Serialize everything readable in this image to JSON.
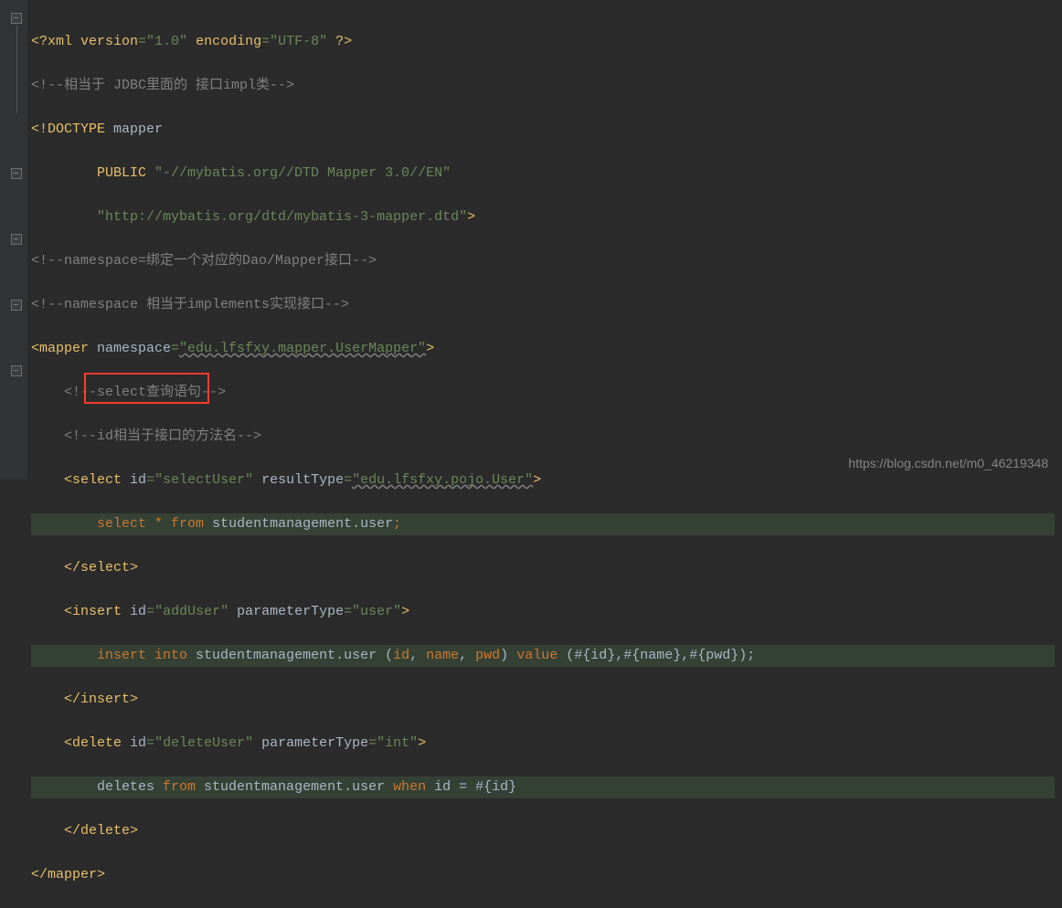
{
  "code": {
    "l1": {
      "a": "<?",
      "b": "xml version",
      "c": "=\"1.0\" ",
      "d": "encoding",
      "e": "=\"UTF-8\" ",
      "f": "?>"
    },
    "l2": "<!--相当于 JDBC里面的 接口impl类-->",
    "l3": {
      "a": "<!",
      "b": "DOCTYPE ",
      "c": "mapper"
    },
    "l4": {
      "a": "PUBLIC ",
      "b": "\"-//mybatis.org//DTD Mapper 3.0//EN\""
    },
    "l5": "\"http://mybatis.org/dtd/mybatis-3-mapper.dtd\"",
    "l5b": ">",
    "l6": "<!--namespace=绑定一个对应的Dao/Mapper接口-->",
    "l7": "<!--namespace 相当于implements实现接口-->",
    "l8": {
      "a": "<mapper ",
      "b": "namespace",
      "c": "=",
      "d": "\"edu.lfsfxy.mapper.UserMapper\"",
      "e": ">"
    },
    "l9": "<!--select查询语句-->",
    "l10": "<!--id相当于接口的方法名-->",
    "l11": {
      "a": "<select ",
      "b": "id",
      "c": "=",
      "d": "\"selectUser\" ",
      "e": "resultType",
      "f": "=",
      "g": "\"edu.lfsfxy.pojo.User\"",
      "h": ">"
    },
    "l12": {
      "a": "select ",
      "b": "* ",
      "c": "from ",
      "d": "studentmanagement.user",
      "e": ";"
    },
    "l13": "</select>",
    "l14": {
      "a": "<insert ",
      "b": "id",
      "c": "=",
      "d": "\"addUser\" ",
      "e": "parameterType",
      "f": "=",
      "g": "\"user\"",
      "h": ">"
    },
    "l15": {
      "a": "insert ",
      "b": "into ",
      "c": "studentmanagement.user (",
      "d": "id",
      "e": ", ",
      "f": "name",
      "g": ", ",
      "h": "pwd",
      "i": ") ",
      "j": "value ",
      "k": "(#{id},#{name},#{pwd});"
    },
    "l16": "</insert>",
    "l17": {
      "a": "<delete ",
      "b": "id",
      "c": "=",
      "d": "\"deleteUser\" ",
      "e": "parameterType",
      "f": "=",
      "g": "\"int\"",
      "h": ">"
    },
    "l18": {
      "a": " deletes ",
      "b": "from ",
      "c": "studentmanagement.user ",
      "d": "when ",
      "e": "id = #{id}"
    },
    "l19": "</delete>",
    "l20": "</mapper>"
  },
  "watermark": "https://blog.csdn.net/m0_46219348"
}
